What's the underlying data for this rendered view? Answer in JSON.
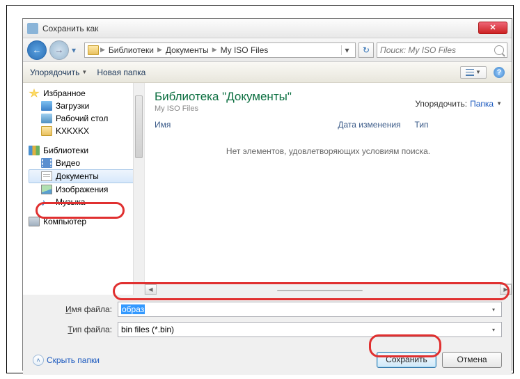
{
  "title": "Сохранить как",
  "close": "✕",
  "nav": {
    "back": "←",
    "fwd": "→",
    "hist": "▾"
  },
  "breadcrumb": {
    "seg1": "Библиотеки",
    "seg2": "Документы",
    "seg3": "My ISO Files"
  },
  "search_placeholder": "Поиск: My ISO Files",
  "toolbar": {
    "organize": "Упорядочить",
    "newfolder": "Новая папка"
  },
  "sidebar": {
    "fav": "Избранное",
    "downloads": "Загрузки",
    "desktop": "Рабочий стол",
    "kxk": "KXKXKX",
    "lib": "Библиотеки",
    "video": "Видео",
    "docs": "Документы",
    "images": "Изображения",
    "music": "Музыка",
    "music_glyph": "♪",
    "computer": "Компьютер"
  },
  "main": {
    "title": "Библиотека \"Документы\"",
    "subtitle": "My ISO Files",
    "organize_lbl": "Упорядочить:",
    "organize_val": "Папка",
    "col_name": "Имя",
    "col_date": "Дата изменения",
    "col_type": "Тип",
    "empty": "Нет элементов, удовлетворяющих условиям поиска."
  },
  "form": {
    "name_label_pre": "Имя файла:",
    "name_label_u": "И",
    "name_label_rest": "мя файла:",
    "name_value": "образ",
    "type_label_u": "Т",
    "type_label_rest": "ип файла:",
    "type_value": "bin files (*.bin)"
  },
  "footer": {
    "hide": "Скрыть папки",
    "save": "Сохранить",
    "cancel": "Отмена"
  }
}
